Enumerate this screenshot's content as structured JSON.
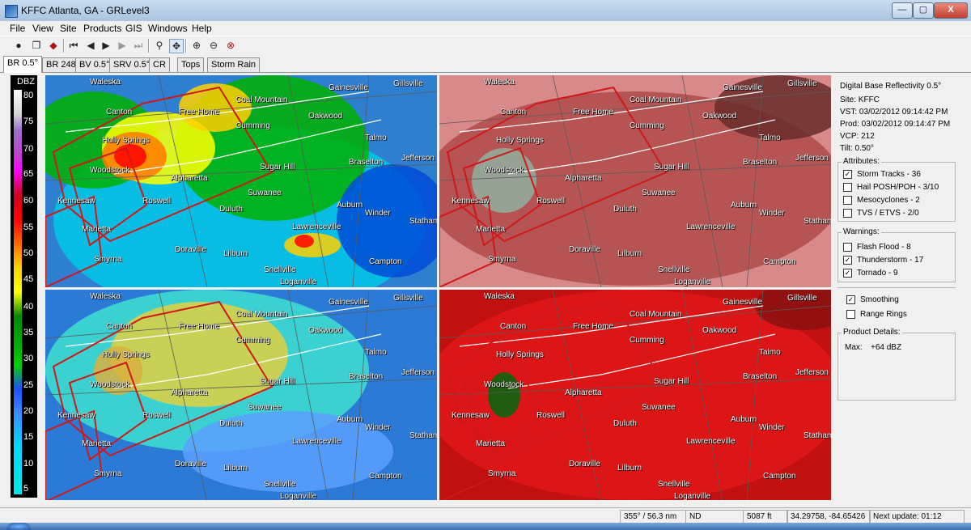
{
  "window": {
    "title": "KFFC Atlanta, GA - GRLevel3",
    "buttons": {
      "minimize": "—",
      "maximize": "▢",
      "close": "X"
    }
  },
  "menu": [
    "File",
    "View",
    "Site",
    "Products",
    "GIS",
    "Windows",
    "Help"
  ],
  "tabs": [
    "BR 0.5°",
    "BR 248",
    "BV 0.5°",
    "SRV 0.5°",
    "CR",
    "Tops",
    "Storm Rain"
  ],
  "colorbar": {
    "label": "DBZ",
    "ticks": [
      "80",
      "75",
      "70",
      "65",
      "60",
      "55",
      "50",
      "45",
      "40",
      "35",
      "30",
      "25",
      "20",
      "15",
      "10",
      "5"
    ]
  },
  "cities": [
    "Waleska",
    "Gainesville",
    "Gillsville",
    "Canton",
    "Free Home",
    "Coal Mountain",
    "Oakwood",
    "Cumming",
    "Talmo",
    "Holly Springs",
    "Woodstock",
    "Alpharetta",
    "Sugar Hill",
    "Braselton",
    "Jefferson",
    "Kennesaw",
    "Roswell",
    "Suwanee",
    "Duluth",
    "Auburn",
    "Winder",
    "Statham",
    "Marietta",
    "Lawrenceville",
    "Smyrna",
    "Doraville",
    "Lilburn",
    "Snellville",
    "Loganville",
    "Campton"
  ],
  "info": {
    "product": "Digital Base Reflectivity 0.5°",
    "site": "Site:  KFFC",
    "vst": "VST:  03/02/2012  09:14:42 PM",
    "prod": "Prod:  03/02/2012  09:14:47 PM",
    "vcp": "VCP:  212",
    "tilt": "Tilt:  0.50°"
  },
  "attributes": {
    "caption": "Attributes:",
    "items": [
      {
        "label": "Storm Tracks - 36",
        "checked": true
      },
      {
        "label": "Hail POSH/POH - 3/10",
        "checked": false
      },
      {
        "label": "Mesocyclones - 2",
        "checked": false
      },
      {
        "label": "TVS / ETVS - 2/0",
        "checked": false
      }
    ]
  },
  "warnings": {
    "caption": "Warnings:",
    "items": [
      {
        "label": "Flash Flood - 8",
        "checked": false
      },
      {
        "label": "Thunderstorm - 17",
        "checked": true
      },
      {
        "label": "Tornado - 9",
        "checked": true
      }
    ]
  },
  "options": [
    {
      "label": "Smoothing",
      "checked": true
    },
    {
      "label": "Range Rings",
      "checked": false
    }
  ],
  "details": {
    "caption": "Product Details:",
    "max_label": "Max:",
    "max_value": "+64 dBZ"
  },
  "status": {
    "azimuth": "355° / 56.3 nm",
    "value": "ND",
    "height": "5087 ft",
    "coords": "34.29758, -84.65426",
    "next_update": "Next update: 01:12"
  },
  "colors": {
    "warning_polygon": "#d01818",
    "track": "#ffffff"
  }
}
